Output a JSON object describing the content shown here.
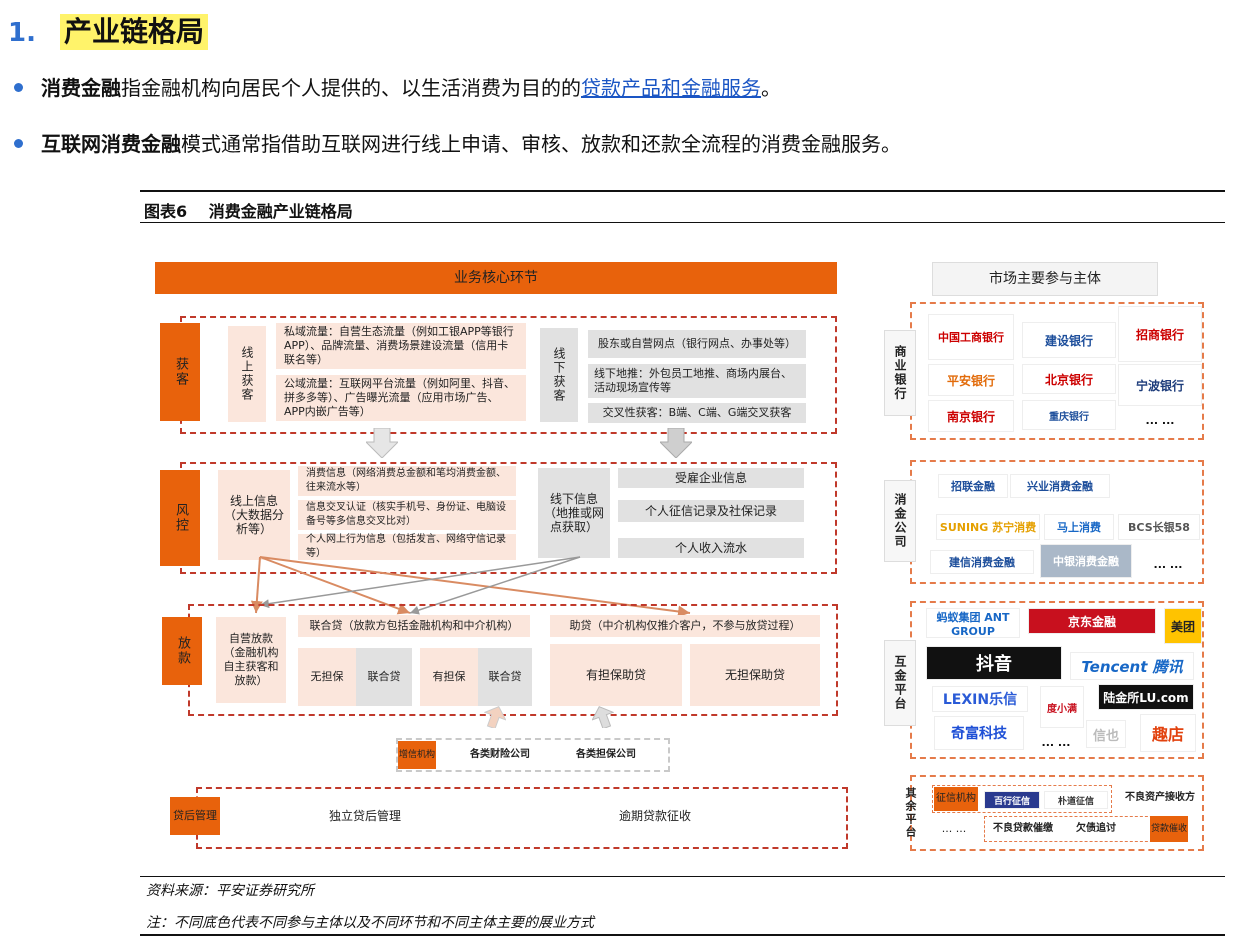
{
  "heading": {
    "number": "1.",
    "title": "产业链格局"
  },
  "bullets": [
    {
      "bold": "消费金融",
      "text": "指金融机构向居民个人提供的、以生活消费为目的的",
      "link": "贷款产品和金融服务",
      "tail": "。"
    },
    {
      "bold": "互联网消费金融",
      "text": "模式通常指借助互联网进行线上申请、审核、放款和还款全流程的消费金融服务。"
    }
  ],
  "figure": {
    "title": "图表6　 消费金融产业链格局"
  },
  "core": {
    "header": "业务核心环节",
    "acquire": {
      "label": "获客",
      "online": "线上获客",
      "online_items": [
        "私域流量：自营生态流量（例如工银APP等银行APP）、品牌流量、消费场景建设流量（信用卡联名等）",
        "公域流量：互联网平台流量（例如阿里、抖音、拼多多等）、广告曝光流量（应用市场广告、APP内嵌广告等）"
      ],
      "offline": "线下获客",
      "offline_items": [
        "股东或自营网点（银行网点、办事处等）",
        "线下地推：外包员工地推、商场内展台、活动现场宣传等",
        "交叉性获客：B端、C端、G端交叉获客"
      ]
    },
    "risk": {
      "label": "风控",
      "online": "线上信息（大数据分析等）",
      "online_items": [
        "消费信息（网络消费总金额和笔均消费金额、往来流水等）",
        "信息交叉认证（核实手机号、身份证、电脑设备号等多信息交叉比对）",
        "个人网上行为信息（包括发言、网络守信记录等）"
      ],
      "offline": "线下信息（地推或网点获取）",
      "offline_items": [
        "受雇企业信息",
        "个人征信记录及社保记录",
        "个人收入流水"
      ]
    },
    "loan": {
      "label": "放款",
      "self": "自营放款（金融机构自主获客和放款）",
      "joint": "联合贷（放款方包括金融机构和中介机构）",
      "joint_items": [
        {
          "a": "无担保",
          "b": "联合贷"
        },
        {
          "a": "有担保",
          "b": "联合贷"
        }
      ],
      "assist": "助贷（中介机构仅推介客户，不参与放贷过程）",
      "assist_items": [
        "有担保助贷",
        "无担保助贷"
      ]
    },
    "credit": {
      "label": "增信机构",
      "items": [
        "各类财险公司",
        "各类担保公司"
      ]
    },
    "post": {
      "label": "贷后管理",
      "items": [
        "独立贷后管理",
        "逾期贷款征收"
      ]
    }
  },
  "market": {
    "header": "市场主要参与主体",
    "banks": {
      "label": "商业银行",
      "logos": [
        "中国工商银行",
        "建设银行",
        "招商银行",
        "平安银行",
        "北京银行",
        "宁波银行",
        "南京银行",
        "重庆银行",
        "... ..."
      ]
    },
    "consumer": {
      "label": "消金公司",
      "logos": [
        "招联金融",
        "兴业消费金融",
        "SUNING 苏宁消费",
        "马上消费",
        "BCS长银58",
        "建信消费金融",
        "中银消费金融",
        "... ..."
      ]
    },
    "internet": {
      "label": "互金平台",
      "logos": [
        "蚂蚁集团 ANT GROUP",
        "京东金融",
        "美团",
        "抖音",
        "Tencent 腾讯",
        "LEXIN乐信",
        "度小满",
        "陆金所LU.com",
        "奇富科技",
        "... ...",
        "信也",
        "趣店"
      ]
    },
    "others": {
      "label": "其余平台",
      "credit_label": "征信机构",
      "credit_logos": [
        "百行征信",
        "朴道征信"
      ],
      "npa": "不良资产接收方",
      "collect_label": "贷款催收",
      "collect_items": [
        "不良贷款催缴",
        "欠债追讨"
      ],
      "more": "... ..."
    }
  },
  "footer": {
    "source": "资料来源：平安证券研究所",
    "note": "注：不同底色代表不同参与主体以及不同环节和不同主体主要的展业方式"
  },
  "colors": {
    "accent": "#e8620c",
    "dash": "#c0392b",
    "blue": "#2f6fce"
  }
}
